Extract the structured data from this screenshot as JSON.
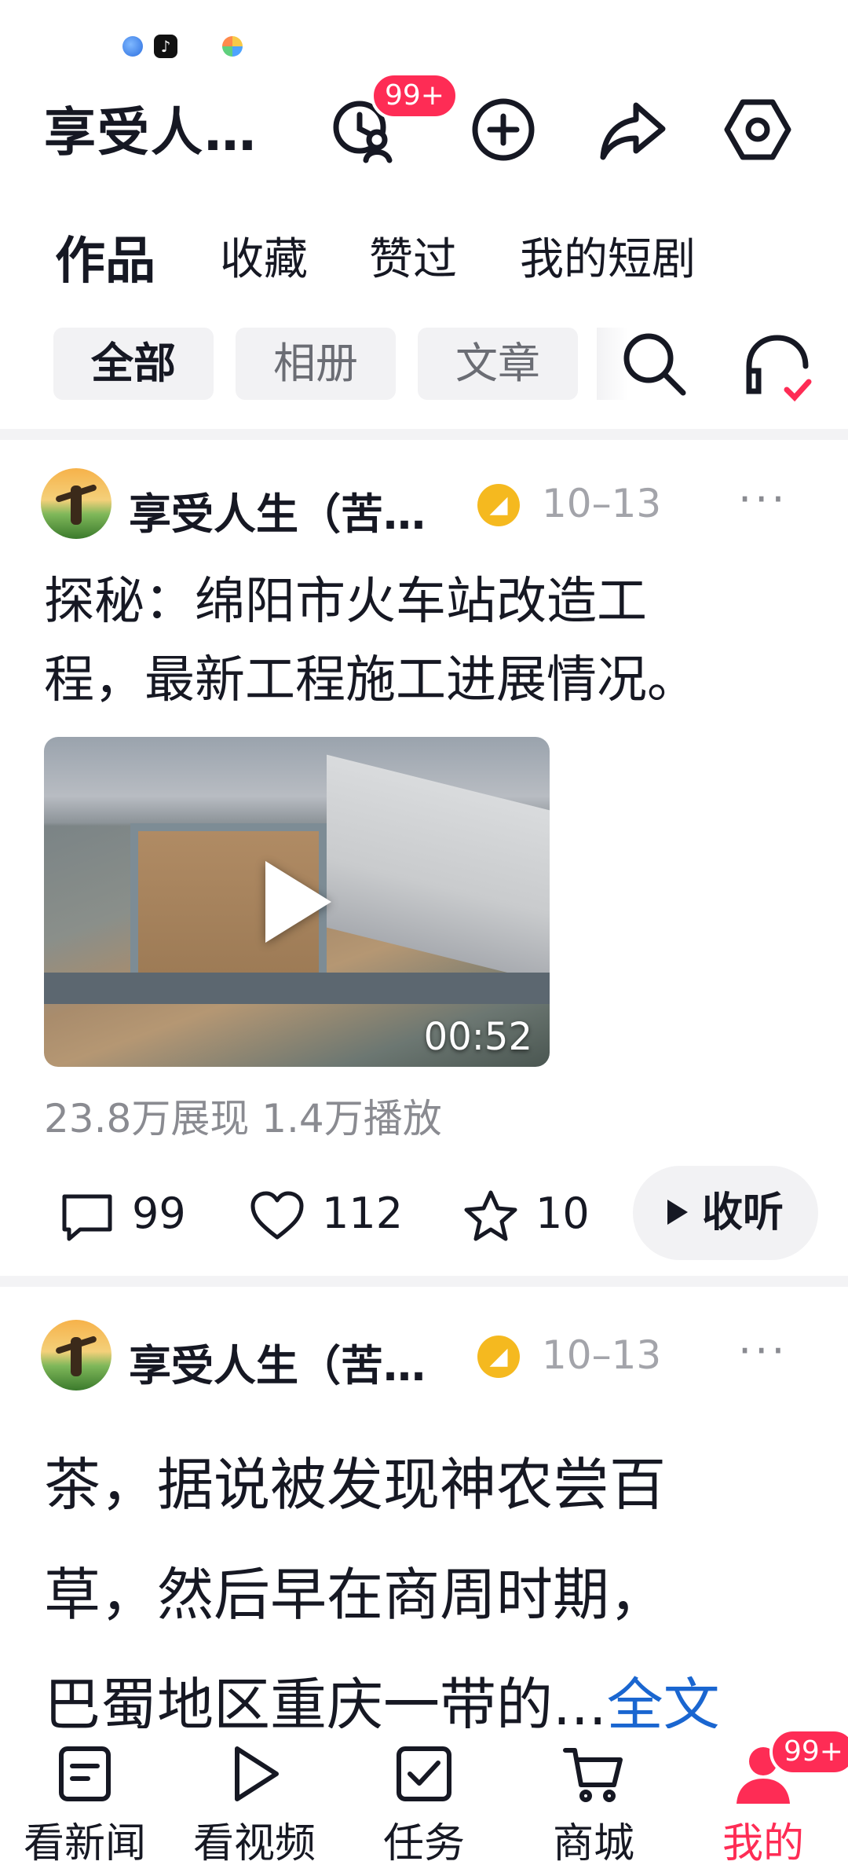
{
  "header": {
    "title": "享受人…",
    "history_badge": "99+"
  },
  "tabs": [
    {
      "label": "作品",
      "active": true
    },
    {
      "label": "收藏",
      "active": false
    },
    {
      "label": "赞过",
      "active": false
    },
    {
      "label": "我的短剧",
      "active": false
    }
  ],
  "filters": [
    {
      "label": "全部",
      "active": true
    },
    {
      "label": "相册",
      "active": false
    },
    {
      "label": "文章",
      "active": false
    }
  ],
  "post1": {
    "author": "享受人生（苦…",
    "date": "10–13",
    "text_line1": "探秘：绵阳市火车站改造工",
    "text_line2": "程，最新工程施工进展情况。",
    "video_duration": "00:52",
    "stats": "23.8万展现  1.4万播放",
    "comments": "99",
    "likes": "112",
    "favorites": "10",
    "listen_label": "收听"
  },
  "post2": {
    "author": "享受人生（苦…",
    "date": "10–13",
    "text_line1": "茶，据说被发现神农尝百",
    "text_line2": "草，然后早在商周时期，",
    "text_line3": "巴蜀地区重庆一带的...",
    "read_more": "全文"
  },
  "bottom_nav": [
    {
      "label": "看新闻",
      "icon": "news-icon"
    },
    {
      "label": "看视频",
      "icon": "video-icon"
    },
    {
      "label": "任务",
      "icon": "task-icon"
    },
    {
      "label": "商城",
      "icon": "cart-icon"
    },
    {
      "label": "我的",
      "icon": "user-icon",
      "active": true
    }
  ],
  "mine_badge": "99+",
  "colors": {
    "accent": "#fe2c55",
    "link": "#1a66d0",
    "verified": "#f5b91f"
  }
}
